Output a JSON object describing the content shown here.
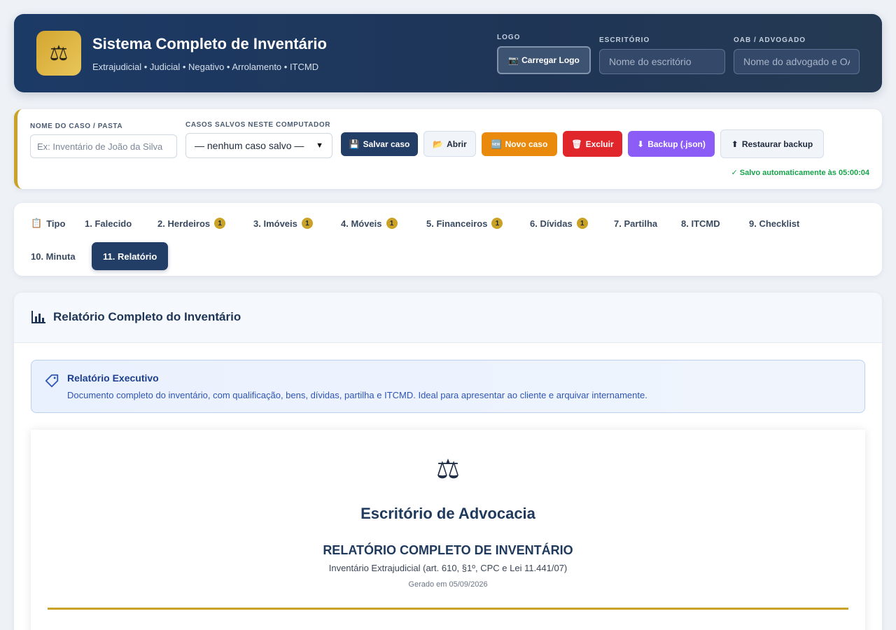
{
  "header": {
    "logo_glyph": "⚖",
    "title": "Sistema Completo de Inventário",
    "subtitle": "Extrajudicial • Judicial • Negativo • Arrolamento • ITCMD",
    "logo_label": "LOGO",
    "logo_button": "Carregar Logo",
    "logo_button_icon": "📷",
    "office_label": "ESCRITÓRIO",
    "office_placeholder": "Nome do escritório",
    "oab_label": "OAB / ADVOGADO",
    "oab_placeholder": "Nome do advogado e OAB"
  },
  "case_bar": {
    "case_name_label": "NOME DO CASO / PASTA",
    "case_name_placeholder": "Ex: Inventário de João da Silva",
    "saved_cases_label": "CASOS SALVOS NESTE COMPUTADOR",
    "saved_cases_selected": "— nenhum caso salvo —",
    "buttons": {
      "save": "Salvar caso",
      "open": "Abrir",
      "new": "Novo caso",
      "delete": "Excluir",
      "backup": "Backup (.json)",
      "restore": "Restaurar backup"
    },
    "icons": {
      "save": "💾",
      "open": "📂",
      "new": "🆕",
      "delete": "🗑",
      "backup": "⬇",
      "restore": "⬆"
    },
    "autosave_status": "✓ Salvo automaticamente às 05:00:04",
    "colors": {
      "save": "#233e66",
      "new": "#ea8a0c",
      "delete": "#e1262b",
      "backup": "#8b5cf6",
      "accent": "#c9a227"
    }
  },
  "tabs": [
    {
      "label": "Tipo",
      "icon": "📋"
    },
    {
      "label": "1. Falecido"
    },
    {
      "label": "2. Herdeiros",
      "badge": "1"
    },
    {
      "label": "3. Imóveis",
      "badge": "1"
    },
    {
      "label": "4. Móveis",
      "badge": "1"
    },
    {
      "label": "5. Financeiros",
      "badge": "1"
    },
    {
      "label": "6. Dívidas",
      "badge": "1"
    },
    {
      "label": "7. Partilha"
    },
    {
      "label": "8. ITCMD"
    },
    {
      "label": "9. Checklist"
    },
    {
      "label": "10. Minuta"
    },
    {
      "label": "11. Relatório",
      "active": true
    }
  ],
  "content": {
    "title": "Relatório Completo do Inventário",
    "info_title": "Relatório Executivo",
    "info_description": "Documento completo do inventário, com qualificação, bens, dívidas, partilha e ITCMD. Ideal para apresentar ao cliente e arquivar internamente.",
    "report": {
      "emblem": "⚖",
      "office_name": "Escritório de Advocacia",
      "title": "RELATÓRIO COMPLETO DE INVENTÁRIO",
      "subtitle": "Inventário Extrajudicial (art. 610, §1º, CPC e Lei 11.441/07)",
      "generated": "Gerado em 05/09/2026"
    }
  }
}
